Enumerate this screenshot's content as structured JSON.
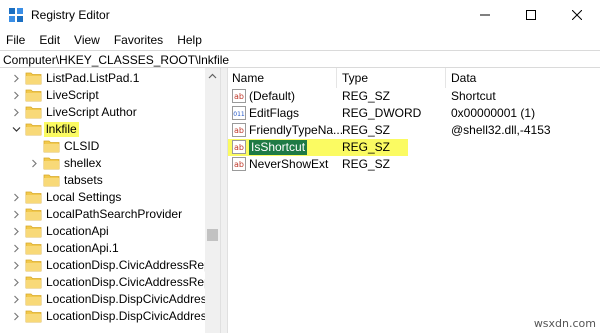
{
  "window": {
    "title": "Registry Editor",
    "app_icon": "registry-editor-icon"
  },
  "menu": [
    "File",
    "Edit",
    "View",
    "Favorites",
    "Help"
  ],
  "address": "Computer\\HKEY_CLASSES_ROOT\\lnkfile",
  "tree": [
    {
      "label": "ListPad.ListPad.1",
      "expandable": true,
      "expanded": false,
      "indent": 0
    },
    {
      "label": "LiveScript",
      "expandable": true,
      "expanded": false,
      "indent": 0
    },
    {
      "label": "LiveScript Author",
      "expandable": true,
      "expanded": false,
      "indent": 0
    },
    {
      "label": "lnkfile",
      "expandable": true,
      "expanded": true,
      "indent": 0,
      "highlighted": true
    },
    {
      "label": "CLSID",
      "expandable": false,
      "expanded": false,
      "indent": 1
    },
    {
      "label": "shellex",
      "expandable": true,
      "expanded": false,
      "indent": 1
    },
    {
      "label": "tabsets",
      "expandable": false,
      "expanded": false,
      "indent": 1
    },
    {
      "label": "Local Settings",
      "expandable": true,
      "expanded": false,
      "indent": 0
    },
    {
      "label": "LocalPathSearchProvider",
      "expandable": true,
      "expanded": false,
      "indent": 0
    },
    {
      "label": "LocationApi",
      "expandable": true,
      "expanded": false,
      "indent": 0
    },
    {
      "label": "LocationApi.1",
      "expandable": true,
      "expanded": false,
      "indent": 0
    },
    {
      "label": "LocationDisp.CivicAddressReport",
      "expandable": true,
      "expanded": false,
      "indent": 0
    },
    {
      "label": "LocationDisp.CivicAddressReport",
      "expandable": true,
      "expanded": false,
      "indent": 0
    },
    {
      "label": "LocationDisp.DispCivicAddressRe",
      "expandable": true,
      "expanded": false,
      "indent": 0
    },
    {
      "label": "LocationDisp.DispCivicAddressRe",
      "expandable": true,
      "expanded": false,
      "indent": 0
    }
  ],
  "columns": {
    "name": "Name",
    "type": "Type",
    "data": "Data"
  },
  "values": [
    {
      "name": "(Default)",
      "type": "REG_SZ",
      "data": "Shortcut",
      "icon": "string-value-icon"
    },
    {
      "name": "EditFlags",
      "type": "REG_DWORD",
      "data": "0x00000001 (1)",
      "icon": "binary-value-icon"
    },
    {
      "name": "FriendlyTypeNa...",
      "type": "REG_SZ",
      "data": "@shell32.dll,-4153",
      "icon": "string-value-icon"
    },
    {
      "name": "IsShortcut",
      "type": "REG_SZ",
      "data": "",
      "icon": "string-value-icon",
      "highlighted": true
    },
    {
      "name": "NeverShowExt",
      "type": "REG_SZ",
      "data": "",
      "icon": "string-value-icon"
    }
  ],
  "watermark": "wsxdn.com",
  "colors": {
    "highlight_yellow": "#fbfb62",
    "selection_green": "#1e7a45",
    "folder_yellow": "#f2c94c"
  }
}
